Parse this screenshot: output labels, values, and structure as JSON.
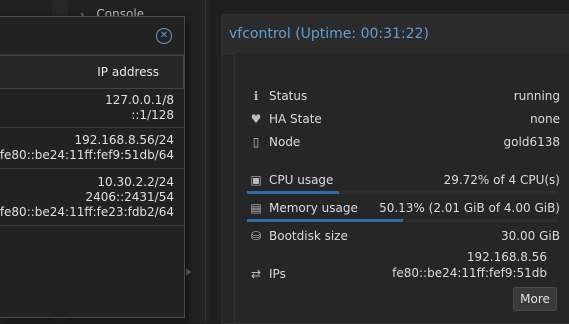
{
  "background": {
    "console_label": "Console"
  },
  "panel": {
    "title": "vfcontrol (Uptime: 00:31:22)",
    "status": {
      "label": "Status",
      "value": "running",
      "icon": "info-icon"
    },
    "ha_state": {
      "label": "HA State",
      "value": "none",
      "icon": "heartbeat-icon"
    },
    "node": {
      "label": "Node",
      "value": "gold6138",
      "icon": "node-icon"
    },
    "cpu": {
      "label": "CPU usage",
      "value": "29.72% of 4 CPU(s)",
      "icon": "cpu-icon",
      "fraction": 0.2972
    },
    "memory": {
      "label": "Memory usage",
      "value": "50.13% (2.01 GiB of 4.00 GiB)",
      "icon": "memory-icon",
      "fraction": 0.5013
    },
    "bootdisk": {
      "label": "Bootdisk size",
      "value": "30.00 GiB",
      "icon": "disk-icon"
    },
    "ips": {
      "label": "IPs",
      "values": [
        "192.168.8.56",
        "fe80::be24:11ff:fef9:51db"
      ],
      "icon": "exchange-icon"
    },
    "more_label": "More"
  },
  "dialog": {
    "column_header": "IP address",
    "rows": [
      {
        "lines": [
          "127.0.0.1/8",
          "::1/128"
        ]
      },
      {
        "lines": [
          "192.168.8.56/24",
          "fe80::be24:11ff:fef9:51db/64"
        ]
      },
      {
        "lines": [
          "10.30.2.2/24",
          "2406::2431/54",
          "fe80::be24:11ff:fe23:fdb2/64"
        ]
      }
    ]
  },
  "colors": {
    "accent": "#5f9fd6",
    "bar_fill": "#2b6ea6"
  }
}
